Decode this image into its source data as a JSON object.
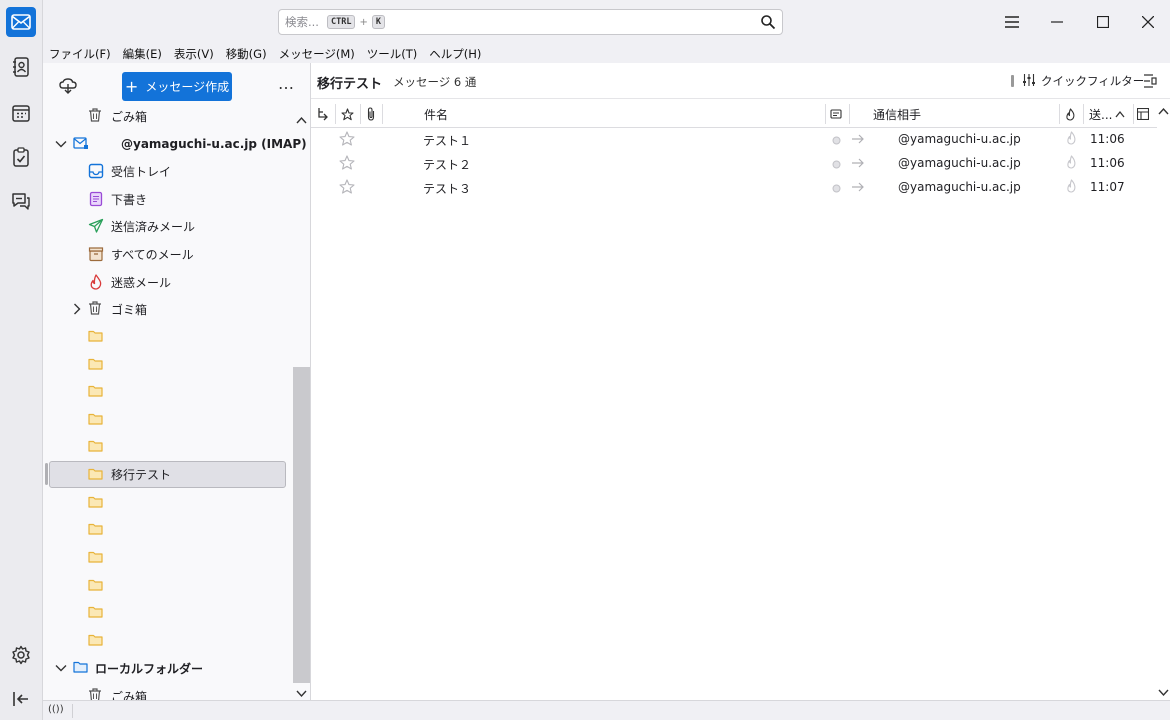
{
  "window": {
    "search_placeholder": "検索...",
    "search_key1": "CTRL",
    "search_plus": "+",
    "search_key2": "K"
  },
  "menubar": [
    "ファイル(F)",
    "編集(E)",
    "表示(V)",
    "移動(G)",
    "メッセージ(M)",
    "ツール(T)",
    "ヘルプ(H)"
  ],
  "folder_pane": {
    "compose_label": "メッセージ作成",
    "more_label": "…",
    "trash_top": "ごみ箱",
    "account": "@yamaguchi-u.ac.jp (IMAP)",
    "inbox": "受信トレイ",
    "drafts": "下書き",
    "sent": "送信済みメール",
    "all_mail": "すべてのメール",
    "junk": "迷惑メール",
    "trash": "ゴミ箱",
    "selected_folder": "移行テスト",
    "local_folders": "ローカルフォルダー",
    "local_trash": "ごみ箱"
  },
  "message_pane": {
    "folder_title": "移行テスト",
    "message_count": "メッセージ 6 通",
    "quick_filter": "クイックフィルター",
    "columns": {
      "subject": "件名",
      "correspondent": "通信相手",
      "date": "送..."
    },
    "messages": [
      {
        "subject": "テスト１",
        "correspondent": "@yamaguchi-u.ac.jp",
        "time": "11:06"
      },
      {
        "subject": "テスト２",
        "correspondent": "@yamaguchi-u.ac.jp",
        "time": "11:06"
      },
      {
        "subject": "テスト３",
        "correspondent": "@yamaguchi-u.ac.jp",
        "time": "11:07"
      }
    ]
  },
  "status_bar": {
    "icon": "(())"
  },
  "colors": {
    "accent": "#1373d9",
    "folder_yellow": "#e8b33a"
  }
}
